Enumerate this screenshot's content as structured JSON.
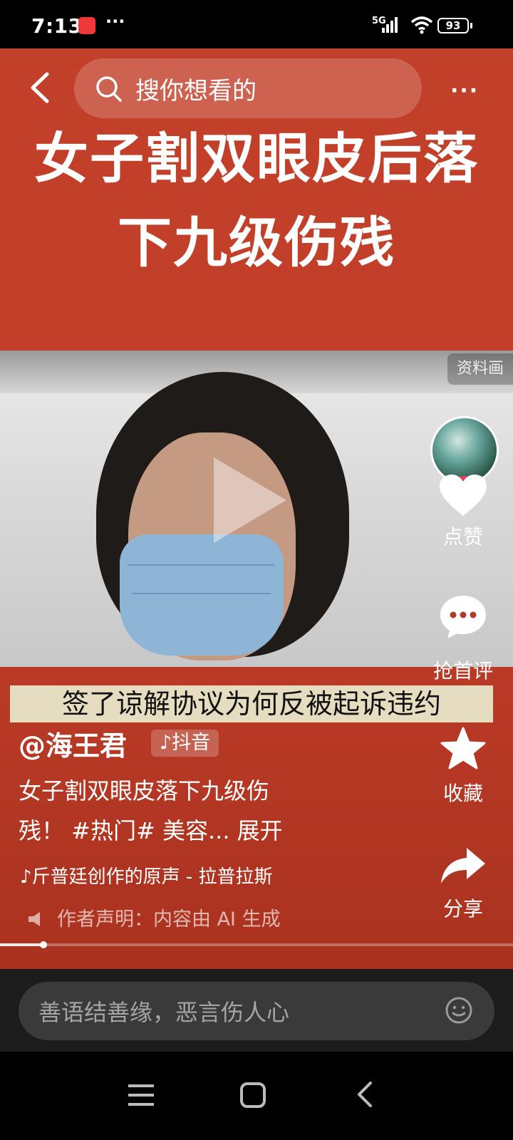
{
  "status_bar": {
    "time": "7:13",
    "network": "5G",
    "battery": "93"
  },
  "top_bar": {
    "search_placeholder": "搜你想看的"
  },
  "headline": {
    "line1": "女子割双眼皮后落",
    "line2": "下九级伤残"
  },
  "subtitle": "签了谅解协议为何反被起诉违约",
  "author": {
    "handle": "@海王君",
    "platform_badge": "♪抖音"
  },
  "description": {
    "line1": "女子割双眼皮落下九级伤",
    "line2": "残！ #热门# 美容...",
    "expand": "展开"
  },
  "music": "♪斤普廷创作的原声 - 拉普拉斯",
  "ai_notice": "作者声明：内容由 AI 生成",
  "side_actions": {
    "info_tag": "资料画",
    "like_label": "点赞",
    "comment_label": "抢首评",
    "favorite_label": "收藏",
    "share_label": "分享"
  },
  "progress": {
    "fraction": 0.08
  },
  "comment_bar": {
    "placeholder": "善语结善缘，恶言伤人心"
  },
  "colors": {
    "video_bg": "#c2402a",
    "follow": "#f23a5a",
    "subtitle_bg": "#e6ddc0"
  }
}
